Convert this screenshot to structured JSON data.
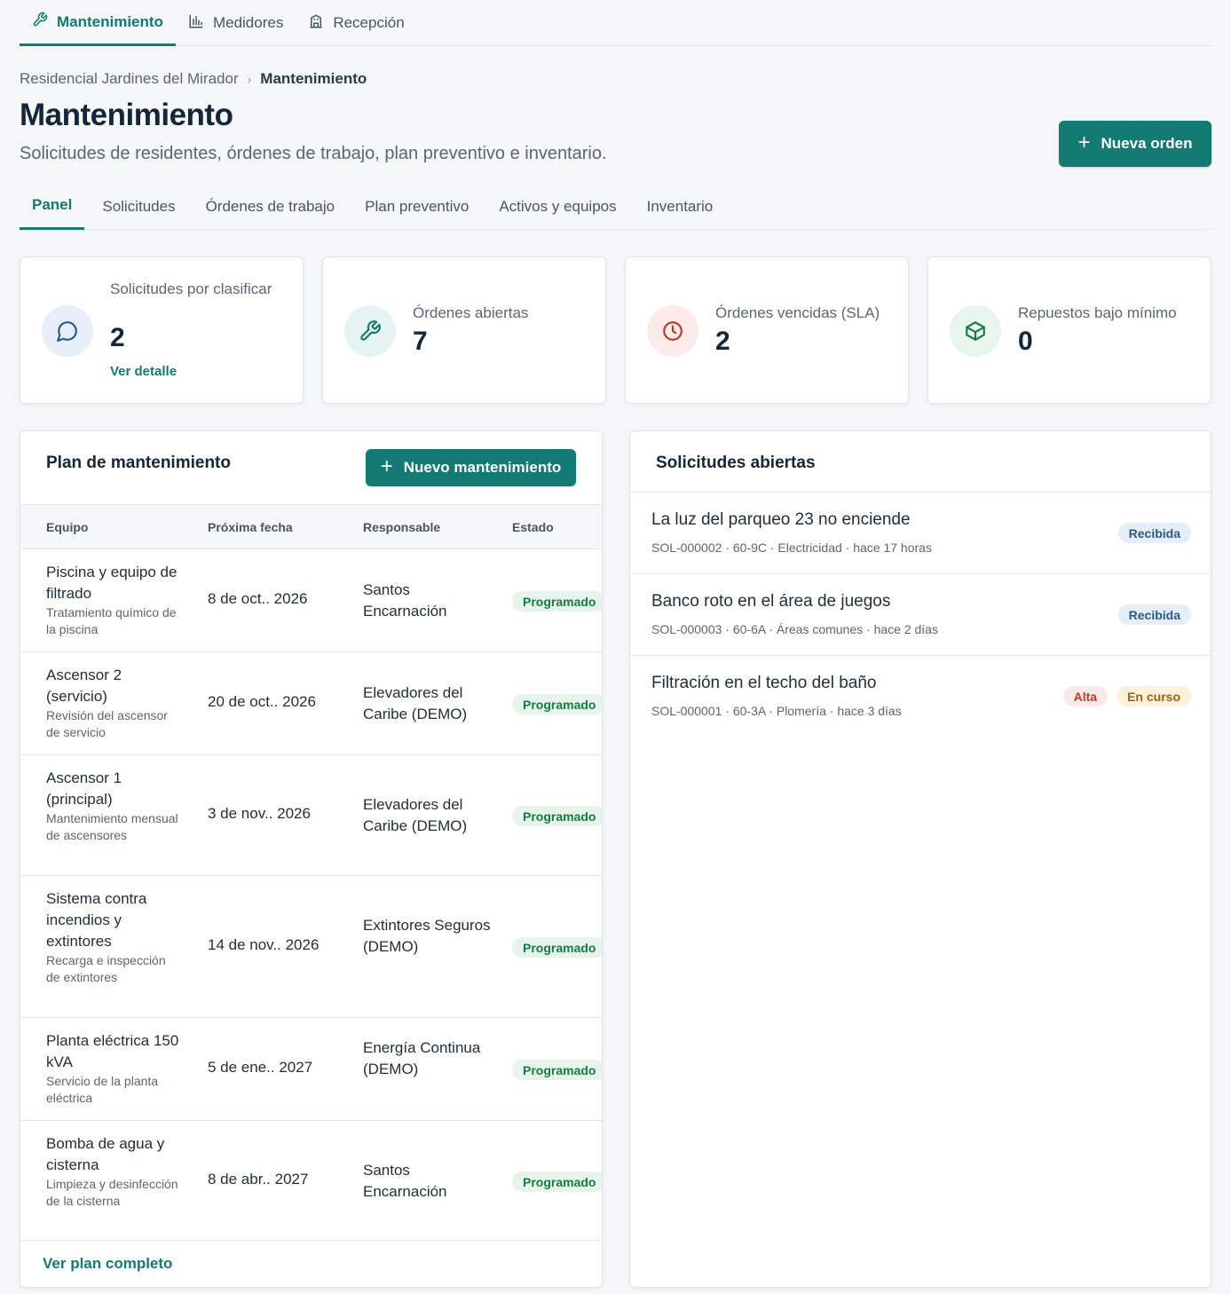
{
  "colors": {
    "accent": "#137a73",
    "danger": "#c0392b",
    "success": "#1a7a43"
  },
  "topnav": [
    {
      "label": "Mantenimiento",
      "icon": "wrench-icon",
      "active": true
    },
    {
      "label": "Medidores",
      "icon": "bar-chart-icon",
      "active": false
    },
    {
      "label": "Recepción",
      "icon": "building-icon",
      "active": false
    }
  ],
  "breadcrumb": {
    "parent": "Residencial Jardines del Mirador",
    "current": "Mantenimiento"
  },
  "header": {
    "title": "Mantenimiento",
    "subtitle": "Solicitudes de residentes, órdenes de trabajo, plan preventivo e inventario.",
    "new_order_label": "Nueva orden"
  },
  "tabs": [
    {
      "label": "Panel",
      "active": true
    },
    {
      "label": "Solicitudes"
    },
    {
      "label": "Órdenes de trabajo"
    },
    {
      "label": "Plan preventivo"
    },
    {
      "label": "Activos y equipos"
    },
    {
      "label": "Inventario"
    }
  ],
  "stats": [
    {
      "label": "Solicitudes por clasificar",
      "value": "2",
      "link": "Ver detalle",
      "icon": "chat-bubble-icon"
    },
    {
      "label": "Órdenes abiertas",
      "value": "7",
      "icon": "wrench-icon"
    },
    {
      "label": "Órdenes vencidas (SLA)",
      "value": "2",
      "icon": "clock-icon"
    },
    {
      "label": "Repuestos bajo mínimo",
      "value": "0",
      "icon": "box-icon"
    }
  ],
  "plan": {
    "title": "Plan de mantenimiento",
    "new_label": "Nuevo mantenimiento",
    "columns": [
      "Equipo",
      "Próxima fecha",
      "Responsable",
      "Estado"
    ],
    "rows": [
      {
        "name": "Piscina y equipo de filtrado",
        "desc": "Tratamiento químico de la piscina",
        "date": "8 de oct.. 2026",
        "resp": "Santos Encarnación",
        "status": "Programado"
      },
      {
        "name": "Ascensor 2 (servicio)",
        "desc": "Revisión del ascensor de servicio",
        "date": "20 de oct.. 2026",
        "resp": "Elevadores del Caribe (DEMO)",
        "status": "Programado"
      },
      {
        "name": "Ascensor 1 (principal)",
        "desc": "Mantenimiento mensual de ascensores",
        "date": "3 de nov.. 2026",
        "resp": "Elevadores del Caribe (DEMO)",
        "status": "Programado"
      },
      {
        "name": "Sistema contra incendios y extintores",
        "desc": "Recarga e inspección de extintores",
        "date": "14 de nov.. 2026",
        "resp": "Extintores Seguros (DEMO)",
        "status": "Programado"
      },
      {
        "name": "Planta eléctrica 150 kVA",
        "desc": "Servicio de la planta eléctrica",
        "date": "5 de ene.. 2027",
        "resp": "Energía Continua (DEMO)",
        "status": "Programado"
      },
      {
        "name": "Bomba de agua y cisterna",
        "desc": "Limpieza y desinfección de la cisterna",
        "date": "8 de abr.. 2027",
        "resp": "Santos Encarnación",
        "status": "Programado"
      }
    ],
    "footer_link": "Ver plan completo"
  },
  "requests": {
    "title": "Solicitudes abiertas",
    "items": [
      {
        "title": "La luz del parqueo 23 no enciende",
        "meta": "SOL-000002 · 60-9C · Electricidad · hace 17 horas",
        "badges": [
          "Recibida"
        ]
      },
      {
        "title": "Banco roto en el área de juegos",
        "meta": "SOL-000003 · 60-6A · Áreas comunes · hace 2 días",
        "badges": [
          "Recibida"
        ]
      },
      {
        "title": "Filtración en el techo del baño",
        "meta": "SOL-000001 · 60-3A · Plomería · hace 3 días",
        "badges": [
          "Alta",
          "En curso"
        ]
      }
    ]
  }
}
